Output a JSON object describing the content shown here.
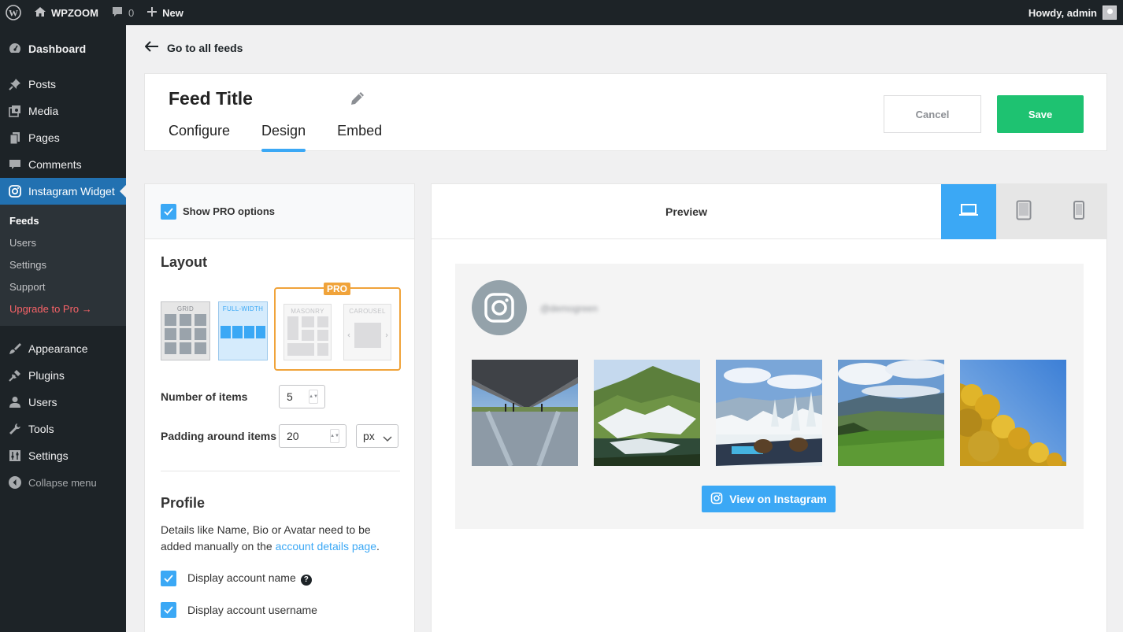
{
  "adminbar": {
    "site_name": "WPZOOM",
    "comments_count": "0",
    "new_label": "New",
    "greeting": "Howdy, admin"
  },
  "sidebar": {
    "items": [
      {
        "label": "Dashboard",
        "icon": "dashboard-icon"
      },
      {
        "label": "Posts",
        "icon": "pin-icon"
      },
      {
        "label": "Media",
        "icon": "media-icon"
      },
      {
        "label": "Pages",
        "icon": "pages-icon"
      },
      {
        "label": "Comments",
        "icon": "comments-icon"
      },
      {
        "label": "Instagram Widget",
        "icon": "instagram-icon"
      },
      {
        "label": "Appearance",
        "icon": "brush-icon"
      },
      {
        "label": "Plugins",
        "icon": "plug-icon"
      },
      {
        "label": "Users",
        "icon": "user-icon"
      },
      {
        "label": "Tools",
        "icon": "wrench-icon"
      },
      {
        "label": "Settings",
        "icon": "sliders-icon"
      }
    ],
    "submenu": [
      "Feeds",
      "Users",
      "Settings",
      "Support",
      "Upgrade to Pro →"
    ],
    "collapse_label": "Collapse menu"
  },
  "main": {
    "back_label": "Go to all feeds",
    "feed_title": "Feed Title",
    "tabs": [
      "Configure",
      "Design",
      "Embed"
    ],
    "active_tab": "Design",
    "cancel_label": "Cancel",
    "save_label": "Save"
  },
  "settings": {
    "show_pro_label": "Show PRO options",
    "show_pro_checked": true,
    "layout_title": "Layout",
    "layouts": [
      "GRID",
      "FULL-WIDTH",
      "MASONRY",
      "CAROUSEL"
    ],
    "pro_badge": "PRO",
    "items_label": "Number of items",
    "items_value": "5",
    "padding_label": "Padding around items",
    "padding_value": "20",
    "padding_unit": "px",
    "profile_title": "Profile",
    "profile_desc": "Details like Name, Bio or Avatar need to be added manually on the",
    "profile_link": "account details page",
    "profile_desc_end": ".",
    "display_name_label": "Display account name",
    "display_username_label": "Display account username"
  },
  "preview": {
    "title": "Preview",
    "devices": [
      "laptop-icon",
      "tablet-icon",
      "phone-icon"
    ],
    "active_device": "laptop-icon",
    "username": "@demogreen",
    "view_label": "View on Instagram"
  },
  "colors": {
    "accent": "#3ba8f5",
    "save": "#1ec271",
    "pro": "#f0a33a",
    "wp_blue": "#2271b1"
  }
}
